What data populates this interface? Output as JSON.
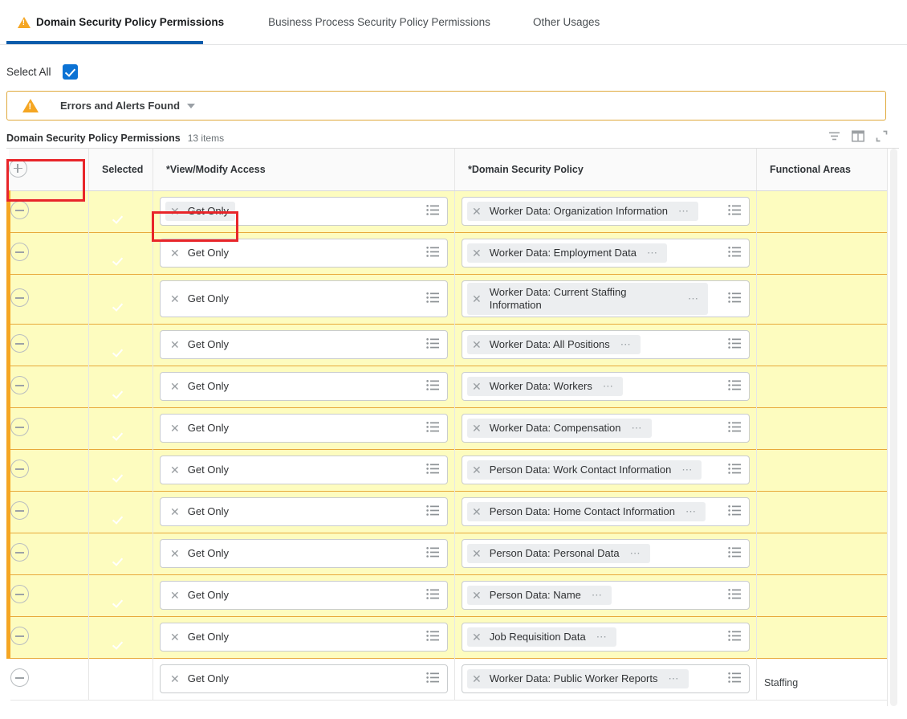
{
  "tabs": [
    {
      "label": "Domain Security Policy Permissions",
      "active": true,
      "warning_icon": "warning-triangle-icon"
    },
    {
      "label": "Business Process Security Policy Permissions",
      "active": false
    },
    {
      "label": "Other Usages",
      "active": false
    }
  ],
  "select_all": {
    "label": "Select All",
    "checked": true
  },
  "alert": {
    "icon": "warning-triangle-icon",
    "text": "Errors and Alerts Found",
    "caret": "chevron-down-icon"
  },
  "table": {
    "caption": "Domain Security Policy Permissions",
    "count": "13 items",
    "toolbar_icons": [
      "filter-icon",
      "column-layout-icon",
      "expand-icon"
    ],
    "columns": {
      "expand": "",
      "selected": "Selected",
      "view_modify": "*View/Modify Access",
      "domain_policy": "*Domain Security Policy",
      "functional_areas": "Functional Areas"
    },
    "add_row_icon": "plus-circle-icon",
    "remove_row_icon": "minus-circle-icon",
    "rows": [
      {
        "selected": true,
        "access": "Get Only",
        "access_highlight": true,
        "policy": "Worker Data: Organization Information",
        "functional_areas": "",
        "highlighted": true,
        "two_line": false
      },
      {
        "selected": true,
        "access": "Get Only",
        "access_highlight": false,
        "policy": "Worker Data: Employment Data",
        "functional_areas": "",
        "highlighted": true,
        "two_line": false
      },
      {
        "selected": true,
        "access": "Get Only",
        "access_highlight": false,
        "policy": "Worker Data: Current Staffing Information",
        "functional_areas": "",
        "highlighted": true,
        "two_line": true
      },
      {
        "selected": true,
        "access": "Get Only",
        "access_highlight": false,
        "policy": "Worker Data: All Positions",
        "functional_areas": "",
        "highlighted": true,
        "two_line": false
      },
      {
        "selected": true,
        "access": "Get Only",
        "access_highlight": false,
        "policy": "Worker Data: Workers",
        "functional_areas": "",
        "highlighted": true,
        "two_line": false
      },
      {
        "selected": true,
        "access": "Get Only",
        "access_highlight": false,
        "policy": "Worker Data: Compensation",
        "functional_areas": "",
        "highlighted": true,
        "two_line": false
      },
      {
        "selected": true,
        "access": "Get Only",
        "access_highlight": false,
        "policy": "Person Data: Work Contact Information",
        "functional_areas": "",
        "highlighted": true,
        "two_line": false
      },
      {
        "selected": true,
        "access": "Get Only",
        "access_highlight": false,
        "policy": "Person Data: Home Contact Information",
        "functional_areas": "",
        "highlighted": true,
        "two_line": false
      },
      {
        "selected": true,
        "access": "Get Only",
        "access_highlight": false,
        "policy": "Person Data: Personal Data",
        "functional_areas": "",
        "highlighted": true,
        "two_line": false
      },
      {
        "selected": true,
        "access": "Get Only",
        "access_highlight": false,
        "policy": "Person Data: Name",
        "functional_areas": "",
        "highlighted": true,
        "two_line": false
      },
      {
        "selected": true,
        "access": "Get Only",
        "access_highlight": false,
        "policy": "Job Requisition Data",
        "functional_areas": "",
        "highlighted": true,
        "two_line": false
      },
      {
        "selected": true,
        "access": "Get Only",
        "access_highlight": false,
        "policy": "Worker Data: Public Worker Reports",
        "functional_areas": "Staffing",
        "highlighted": false,
        "two_line": false
      }
    ],
    "row_icons": {
      "clear": "x-icon",
      "overflow": "ellipsis-icon",
      "prompt": "list-prompt-icon"
    }
  },
  "colors": {
    "accent_blue": "#0b5cab",
    "checkbox_blue": "#0b72d4",
    "warning_orange": "#f5a623",
    "row_highlight": "#fdfcbf",
    "row_border_orange": "#e8a93a",
    "annotation_red": "#e8252a"
  }
}
